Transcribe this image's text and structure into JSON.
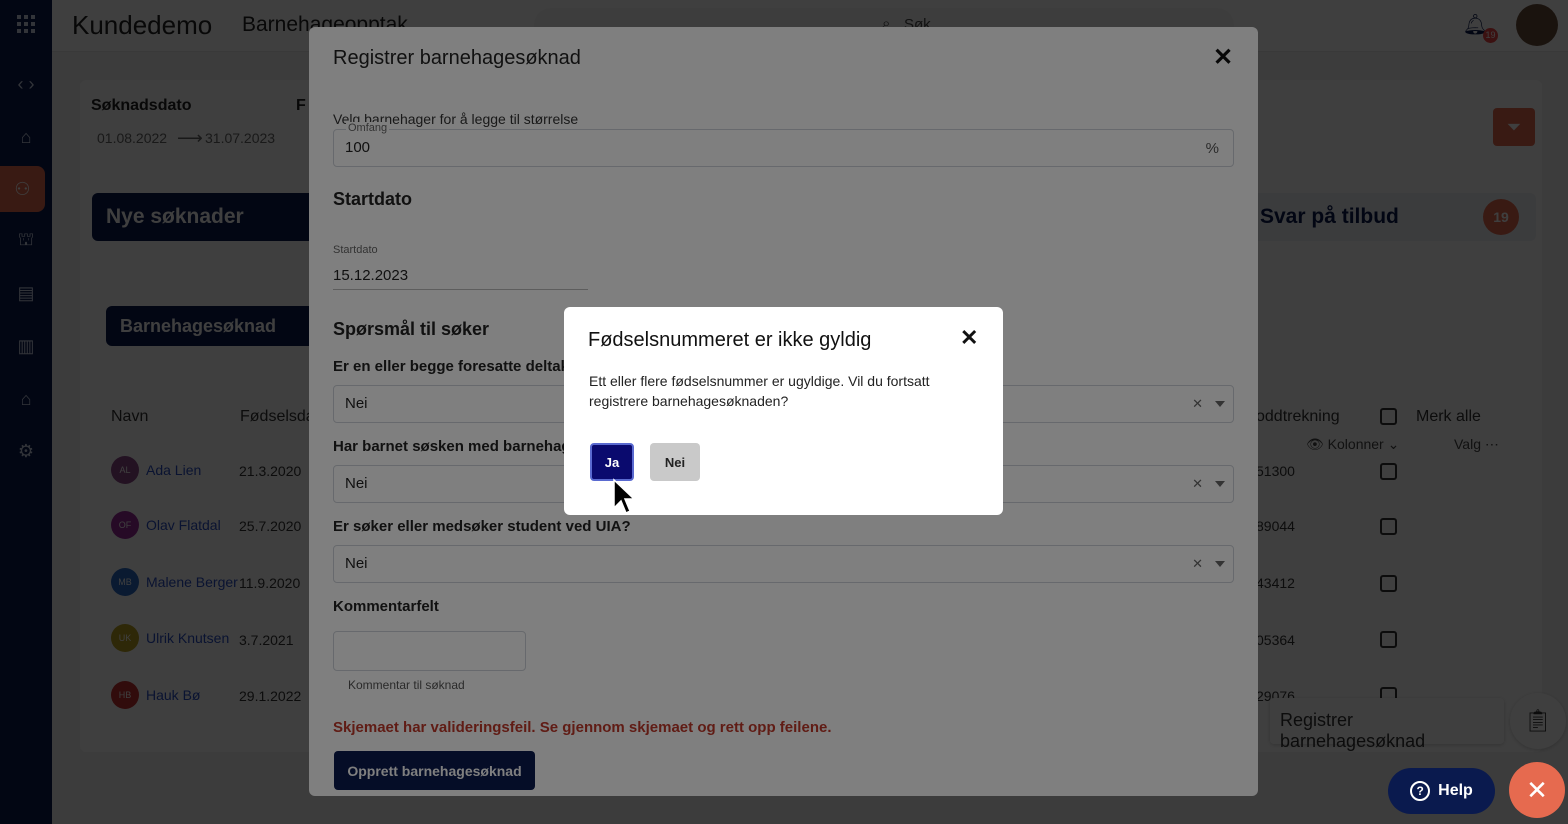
{
  "app": {
    "brand": "Kundedemo",
    "module": "Barnehageopptak",
    "search_placeholder": "Søk",
    "notification_count": "19"
  },
  "filters": {
    "date_label": "Søknadsdato",
    "date_from": "01.08.2022",
    "date_arrow": "⟶",
    "date_to": "31.07.2023",
    "second_label_partial": "F"
  },
  "stats": {
    "new_applications": "Nye søknader",
    "reply_offer": "Svar på tilbud",
    "reply_offer_count": "19"
  },
  "table": {
    "tab_label": "Barnehagesøknad",
    "columns_label": "Kolonner",
    "options_label": "Valg",
    "headers": {
      "name": "Navn",
      "birth": "Fødselsda",
      "lot": "oddtrekning",
      "select_all": "Merk alle"
    },
    "rows": [
      {
        "initials": "AL",
        "name": "Ada Lien",
        "date": "21.3.2020",
        "lot": "51300",
        "color": "#8c4a8a"
      },
      {
        "initials": "OF",
        "name": "Olav Flatdal",
        "date": "25.7.2020",
        "lot": "89044",
        "color": "#9b2a9b"
      },
      {
        "initials": "MB",
        "name": "Malene Berger",
        "date": "11.9.2020",
        "lot": "43412",
        "color": "#2a6ac4"
      },
      {
        "initials": "UK",
        "name": "Ulrik Knutsen",
        "date": "3.7.2021",
        "lot": "05364",
        "color": "#b8a020"
      },
      {
        "initials": "HB",
        "name": "Hauk Bø",
        "date": "29.1.2022",
        "lot": "29076",
        "color": "#c43030"
      }
    ]
  },
  "floating": {
    "register_label": "Registrer barnehagesøknad",
    "help_label": "Help"
  },
  "reg_modal": {
    "title": "Registrer barnehagesøknad",
    "size_hint": "Velg barnehager for å legge til størrelse",
    "scope_label": "Omfang",
    "scope_value": "100",
    "scope_unit": "%",
    "startdate_heading": "Startdato",
    "startdate_label": "Startdato",
    "startdate_value": "15.12.2023",
    "questions_heading": "Spørsmål til søker",
    "q1": "Er en eller begge foresatte deltaker",
    "q1_value": "Nei",
    "q2": "Har barnet søsken med barnehagep",
    "q2_value": "Nei",
    "q3": "Er søker eller medsøker student ved UIA?",
    "q3_value": "Nei",
    "comment_heading": "Kommentarfelt",
    "comment_helper": "Kommentar til søknad",
    "validation_error": "Skjemaet har valideringsfeil. Se gjennom skjemaet og rett opp feilene.",
    "submit_label": "Opprett barnehagesøknad"
  },
  "dialog": {
    "title": "Fødselsnummeret er ikke gyldig",
    "message": "Ett eller flere fødselsnummer er ugyldige. Vil du fortsatt registrere barnehagesøknaden?",
    "yes_label": "Ja",
    "no_label": "Nei"
  },
  "colors": {
    "navy": "#0a1a4e",
    "accent": "#e66a4f",
    "error": "#c0392b"
  }
}
